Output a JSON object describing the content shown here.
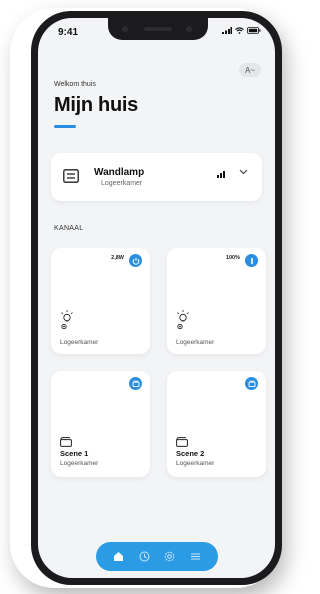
{
  "status_bar": {
    "time": "9:41"
  },
  "header": {
    "avatar_label": "A~",
    "greeting": "Welkom thuis",
    "title": "Mijn huis"
  },
  "device": {
    "name": "Wandlamp",
    "room": "Logeerkamer",
    "icon": "panel-icon"
  },
  "section_label": "KANAAL",
  "channels": [
    {
      "badge": "2,8W",
      "room": "Logeerkamer",
      "icon": "lightbulb-icon",
      "action": "power-icon"
    },
    {
      "badge": "100%",
      "room": "Logeerkamer",
      "icon": "lightbulb-icon",
      "action": "dimmer-icon"
    }
  ],
  "scenes": [
    {
      "name": "Scene 1",
      "room": "Logeerkamer",
      "icon": "scene-icon",
      "action": "play-scene-icon"
    },
    {
      "name": "Scene 2",
      "room": "Logeerkamer",
      "icon": "scene-icon",
      "action": "play-scene-icon"
    }
  ],
  "tabbar": [
    "home-icon",
    "clock-icon",
    "settings-icon",
    "menu-icon"
  ],
  "colors": {
    "accent": "#2a8ee0",
    "background": "#f3f4f6",
    "card": "#ffffff"
  }
}
